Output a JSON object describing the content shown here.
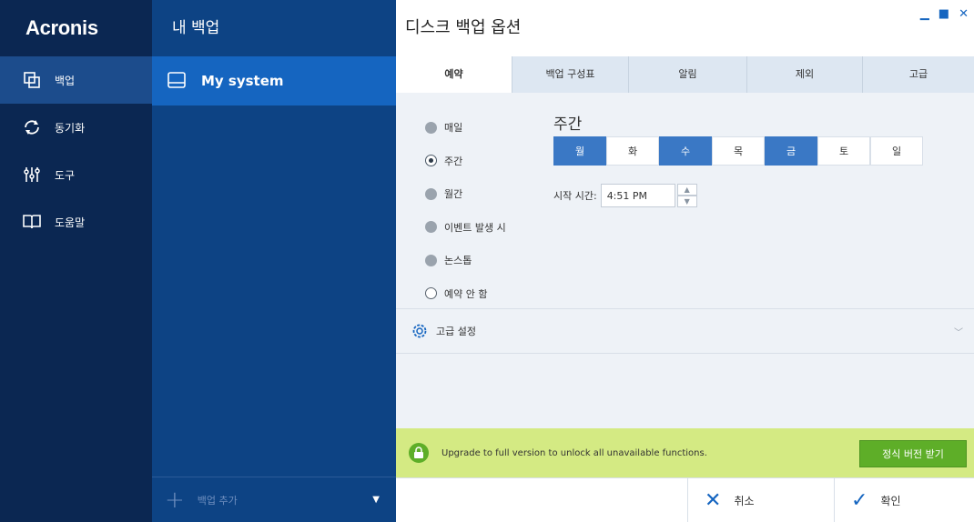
{
  "nav": {
    "brand": "Acronis",
    "items": [
      {
        "label": "백업",
        "icon": "backup-copy-icon",
        "active": true
      },
      {
        "label": "동기화",
        "icon": "sync-icon",
        "active": false
      },
      {
        "label": "도구",
        "icon": "tools-icon",
        "active": false
      },
      {
        "label": "도움말",
        "icon": "book-icon",
        "active": false
      }
    ]
  },
  "backups": {
    "title": "내 백업",
    "items": [
      {
        "label": "My system",
        "icon": "hard-drive-icon"
      }
    ],
    "add_label": "백업 추가"
  },
  "dialog": {
    "title": "디스크 백업 옵션",
    "tabs": [
      "예약",
      "백업 구성표",
      "알림",
      "제외",
      "고급"
    ],
    "active_tab": 0,
    "schedule_options": [
      {
        "label": "매일",
        "state": "disabled"
      },
      {
        "label": "주간",
        "state": "selected"
      },
      {
        "label": "월간",
        "state": "disabled"
      },
      {
        "label": "이벤트 발생 시",
        "state": "disabled"
      },
      {
        "label": "논스톱",
        "state": "disabled"
      },
      {
        "label": "예약 안 함",
        "state": "unselected"
      }
    ],
    "weekly": {
      "title": "주간",
      "days": [
        {
          "label": "월",
          "on": true
        },
        {
          "label": "화",
          "on": false
        },
        {
          "label": "수",
          "on": true
        },
        {
          "label": "목",
          "on": false
        },
        {
          "label": "금",
          "on": true
        },
        {
          "label": "토",
          "on": false
        },
        {
          "label": "일",
          "on": false
        }
      ],
      "start_label": "시작 시간:",
      "start_time": "4:51 PM"
    },
    "advanced_label": "고급 설정",
    "upgrade": {
      "message": "Upgrade to full version to unlock all unavailable functions.",
      "button": "정식 버전 받기"
    },
    "cancel_label": "취소",
    "ok_label": "확인"
  },
  "colors": {
    "nav_bg": "#0b2752",
    "list_bg": "#0d4384",
    "accent": "#1565c0",
    "day_on": "#3a78c5",
    "upgrade_bg": "#d4ea83",
    "upgrade_btn": "#5eae28"
  }
}
